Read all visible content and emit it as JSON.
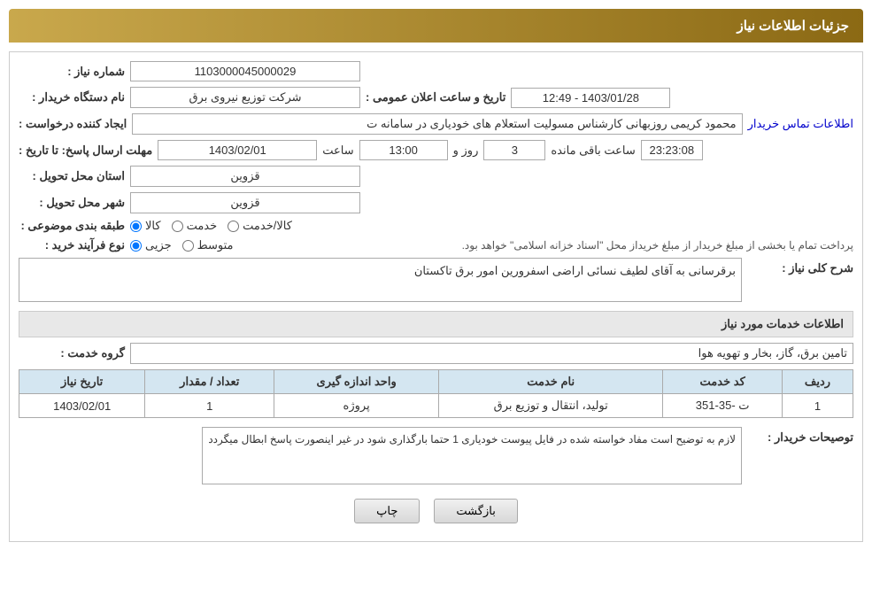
{
  "header": {
    "title": "جزئیات اطلاعات نیاز"
  },
  "fields": {
    "shomara_niaz_label": "شماره نیاز :",
    "shomara_niaz_value": "1103000045000029",
    "nam_dastgah_label": "نام دستگاه خریدار :",
    "nam_dastgah_value": "شرکت توزیع نیروی برق",
    "ijad_label": "ایجاد کننده درخواست :",
    "ijad_value": "محمود کریمی روزبهانی کارشناس  مسولیت استعلام های خودیاری در سامانه ت",
    "ijad_link": "اطلاعات تماس خریدار",
    "mohlat_label": "مهلت ارسال پاسخ: تا تاریخ :",
    "date_value": "1403/02/01",
    "time_label": "ساعت",
    "time_value": "13:00",
    "roz_label": "روز و",
    "roz_value": "3",
    "baqi_label": "ساعت باقی مانده",
    "baqi_value": "23:23:08",
    "tarikh_label": "تاریخ و ساعت اعلان عمومی :",
    "tarikh_value": "1403/01/28 - 12:49",
    "ostan_label": "استان محل تحویل :",
    "ostan_value": "قزوین",
    "shahr_label": "شهر محل تحویل :",
    "shahr_value": "قزوین",
    "tabaqe_label": "طبقه بندی موضوعی :",
    "tabaqe_options": [
      "کالا",
      "خدمت",
      "کالا/خدمت"
    ],
    "tabaqe_selected": "کالا",
    "noe_label": "نوع فرآیند خرید :",
    "noe_options": [
      "جزیی",
      "متوسط"
    ],
    "noe_text": "پرداخت تمام یا بخشی از مبلغ خریدار از مبلغ خریداز محل \"اسناد خزانه اسلامی\" خواهد بود.",
    "sharh_label": "شرح کلی نیاز :",
    "sharh_value": "برقرسانی به آقای لطیف نسائی اراضی اسفرورین امور برق تاکستان"
  },
  "service_section": {
    "title": "اطلاعات خدمات مورد نیاز",
    "group_label": "گروه خدمت :",
    "group_value": "تامین برق، گاز، بخار و تهویه هوا",
    "table": {
      "headers": [
        "ردیف",
        "کد خدمت",
        "نام خدمت",
        "واحد اندازه گیری",
        "تعداد / مقدار",
        "تاریخ نیاز"
      ],
      "rows": [
        [
          "1",
          "ت -35-351",
          "تولید، انتقال و توزیع برق",
          "پروژه",
          "1",
          "1403/02/01"
        ]
      ]
    }
  },
  "toseeh_label": "توصیحات خریدار :",
  "toseeh_value": "لازم به توضیح است مفاد خواسته شده در فایل پیوست خودیاری 1 حتما بارگذاری شود در غیر اینصورت پاسخ ابطال میگردد",
  "buttons": {
    "print": "چاپ",
    "back": "بازگشت"
  }
}
